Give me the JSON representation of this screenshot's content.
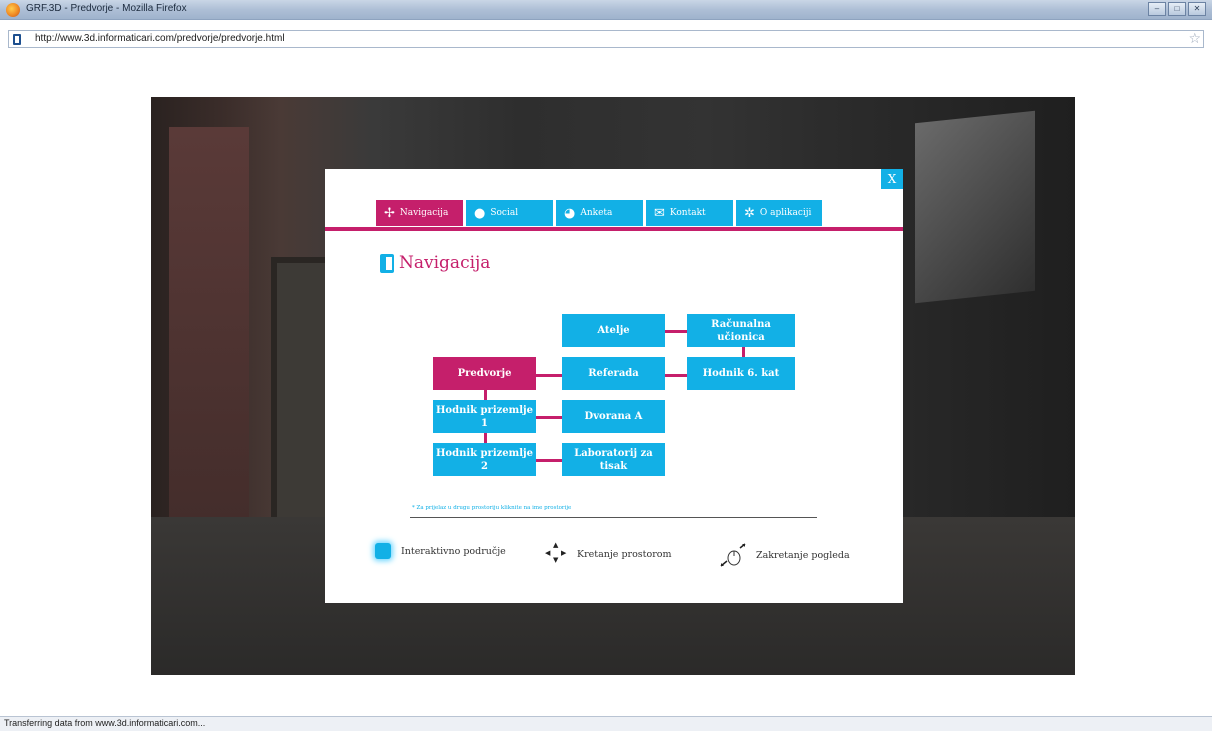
{
  "window": {
    "title": "GRF.3D - Predvorje - Mozilla Firefox",
    "buttons": [
      "–",
      "□",
      "✕"
    ]
  },
  "address": {
    "url": "http://www.3d.informaticari.com/predvorje/predvorje.html"
  },
  "status": {
    "text": "Transferring data from www.3d.informaticari.com..."
  },
  "modal": {
    "close_label": "X",
    "tabs": [
      {
        "label": "Navigacija",
        "icon": "navigation-icon",
        "active": true
      },
      {
        "label": "Social",
        "icon": "speech-bubble-icon",
        "active": false
      },
      {
        "label": "Anketa",
        "icon": "pie-chart-icon",
        "active": false
      },
      {
        "label": "Kontakt",
        "icon": "envelope-icon",
        "active": false
      },
      {
        "label": "O aplikaciji",
        "icon": "gears-icon",
        "active": false
      }
    ],
    "heading": "Navigacija",
    "rooms": {
      "atelje": "Atelje",
      "racunalna": "Računalna učionica",
      "predvorje": "Predvorje",
      "referada": "Referada",
      "hodnik6": "Hodnik 6. kat",
      "hodnik_p1": "Hodnik prizemlje 1",
      "dvorana": "Dvorana A",
      "hodnik_p2": "Hodnik prizemlje 2",
      "laboratorij": "Laboratorij za tisak"
    },
    "hint": "* Za prijelaz u drugu prostoriju kliknite na ime prostorije",
    "legend": {
      "interactive": "Interaktivno područje",
      "move": "Kretanje prostorom",
      "rotate": "Zakretanje pogleda"
    }
  },
  "colors": {
    "accent_blue": "#12b0e6",
    "accent_magenta": "#c51f6b"
  }
}
